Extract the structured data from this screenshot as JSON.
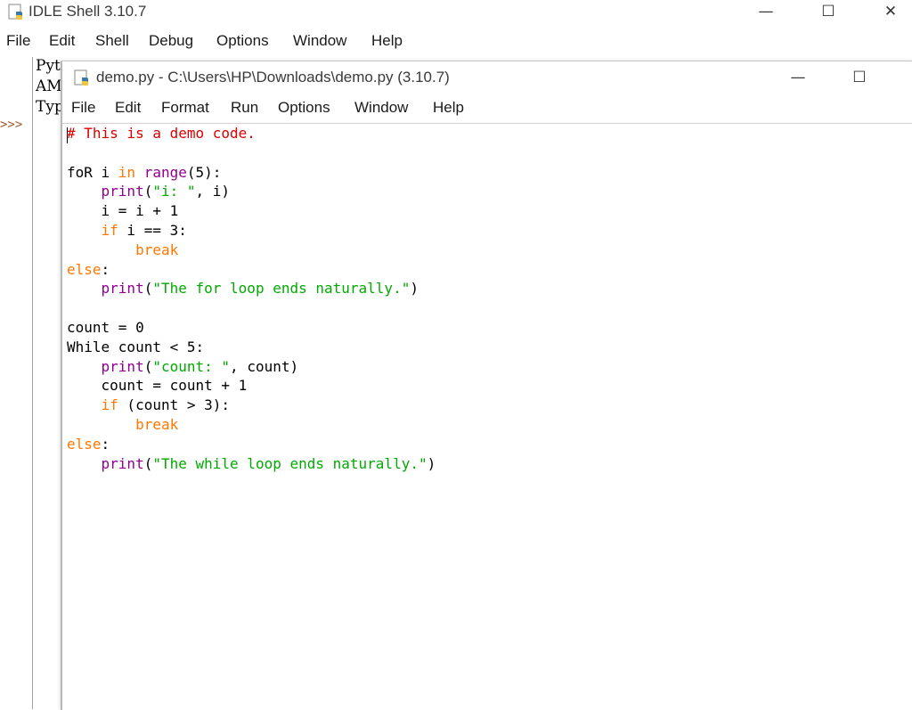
{
  "shell": {
    "title": "IDLE Shell 3.10.7",
    "controls": {
      "minimize": "—",
      "maximize": "☐",
      "close": "✕"
    },
    "menu": [
      "File",
      "Edit",
      "Shell",
      "Debug",
      "Options",
      "Window",
      "Help"
    ],
    "banner_lines": [
      "Pyt",
      "AMI",
      "Typ"
    ],
    "prompt": ">>>"
  },
  "editor": {
    "title": "demo.py - C:\\Users\\HP\\Downloads\\demo.py (3.10.7)",
    "controls": {
      "minimize": "—",
      "maximize": "☐"
    },
    "menu": [
      "File",
      "Edit",
      "Format",
      "Run",
      "Options",
      "Window",
      "Help"
    ],
    "code": [
      [
        {
          "t": "# This is a demo code.",
          "c": "comment"
        }
      ],
      [],
      [
        {
          "t": "foR i ",
          "c": "plain"
        },
        {
          "t": "in",
          "c": "keyword"
        },
        {
          "t": " ",
          "c": "plain"
        },
        {
          "t": "range",
          "c": "builtin"
        },
        {
          "t": "(5):",
          "c": "plain"
        }
      ],
      [
        {
          "t": "    ",
          "c": "plain"
        },
        {
          "t": "print",
          "c": "builtin"
        },
        {
          "t": "(",
          "c": "plain"
        },
        {
          "t": "\"i: \"",
          "c": "string"
        },
        {
          "t": ", i)",
          "c": "plain"
        }
      ],
      [
        {
          "t": "    i = i + 1",
          "c": "plain"
        }
      ],
      [
        {
          "t": "    ",
          "c": "plain"
        },
        {
          "t": "if",
          "c": "keyword"
        },
        {
          "t": " i == 3:",
          "c": "plain"
        }
      ],
      [
        {
          "t": "        ",
          "c": "plain"
        },
        {
          "t": "break",
          "c": "keyword"
        }
      ],
      [
        {
          "t": "else",
          "c": "keyword"
        },
        {
          "t": ":",
          "c": "plain"
        }
      ],
      [
        {
          "t": "    ",
          "c": "plain"
        },
        {
          "t": "print",
          "c": "builtin"
        },
        {
          "t": "(",
          "c": "plain"
        },
        {
          "t": "\"The for loop ends naturally.\"",
          "c": "string"
        },
        {
          "t": ")",
          "c": "plain"
        }
      ],
      [],
      [
        {
          "t": "count = 0",
          "c": "plain"
        }
      ],
      [
        {
          "t": "While count < 5:",
          "c": "plain"
        }
      ],
      [
        {
          "t": "    ",
          "c": "plain"
        },
        {
          "t": "print",
          "c": "builtin"
        },
        {
          "t": "(",
          "c": "plain"
        },
        {
          "t": "\"count: \"",
          "c": "string"
        },
        {
          "t": ", count)",
          "c": "plain"
        }
      ],
      [
        {
          "t": "    count = count + 1",
          "c": "plain"
        }
      ],
      [
        {
          "t": "    ",
          "c": "plain"
        },
        {
          "t": "if",
          "c": "keyword"
        },
        {
          "t": " (count > 3):",
          "c": "plain"
        }
      ],
      [
        {
          "t": "        ",
          "c": "plain"
        },
        {
          "t": "break",
          "c": "keyword"
        }
      ],
      [
        {
          "t": "else",
          "c": "keyword"
        },
        {
          "t": ":",
          "c": "plain"
        }
      ],
      [
        {
          "t": "    ",
          "c": "plain"
        },
        {
          "t": "print",
          "c": "builtin"
        },
        {
          "t": "(",
          "c": "plain"
        },
        {
          "t": "\"The while loop ends naturally.\"",
          "c": "string"
        },
        {
          "t": ")",
          "c": "plain"
        }
      ]
    ]
  },
  "colors": {
    "comment": "#dd0000",
    "keyword": "#ff7700",
    "builtin": "#900090",
    "string": "#00aa00"
  },
  "icons": {
    "app": "python-idle-icon",
    "minimize": "minimize-icon",
    "maximize": "maximize-icon",
    "close": "close-icon"
  }
}
